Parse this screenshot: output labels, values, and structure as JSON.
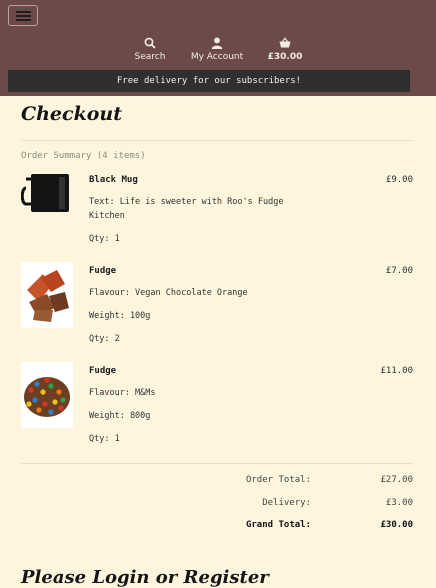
{
  "header": {
    "nav": {
      "search": "Search",
      "account": "My Account",
      "basket": "£30.00"
    },
    "banner": "Free delivery for our subscribers!"
  },
  "page": {
    "title": "Checkout",
    "summary_label": "Order Summary (4 items)"
  },
  "items": [
    {
      "name": "Black Mug",
      "price": "£9.00",
      "details": [
        "Text: Life is sweeter with Roo's Fudge Kitchen",
        "Qty: 1"
      ]
    },
    {
      "name": "Fudge",
      "price": "£7.00",
      "details": [
        "Flavour: Vegan Chocolate Orange",
        "Weight: 100g",
        "Qty: 2"
      ]
    },
    {
      "name": "Fudge",
      "price": "£11.00",
      "details": [
        "Flavour: M&Ms",
        "Weight: 800g",
        "Qty: 1"
      ]
    }
  ],
  "totals": {
    "order_label": "Order Total:",
    "order_value": "£27.00",
    "delivery_label": "Delivery:",
    "delivery_value": "£3.00",
    "grand_label": "Grand Total:",
    "grand_value": "£30.00"
  },
  "login": {
    "title": "Please Login or Register"
  }
}
